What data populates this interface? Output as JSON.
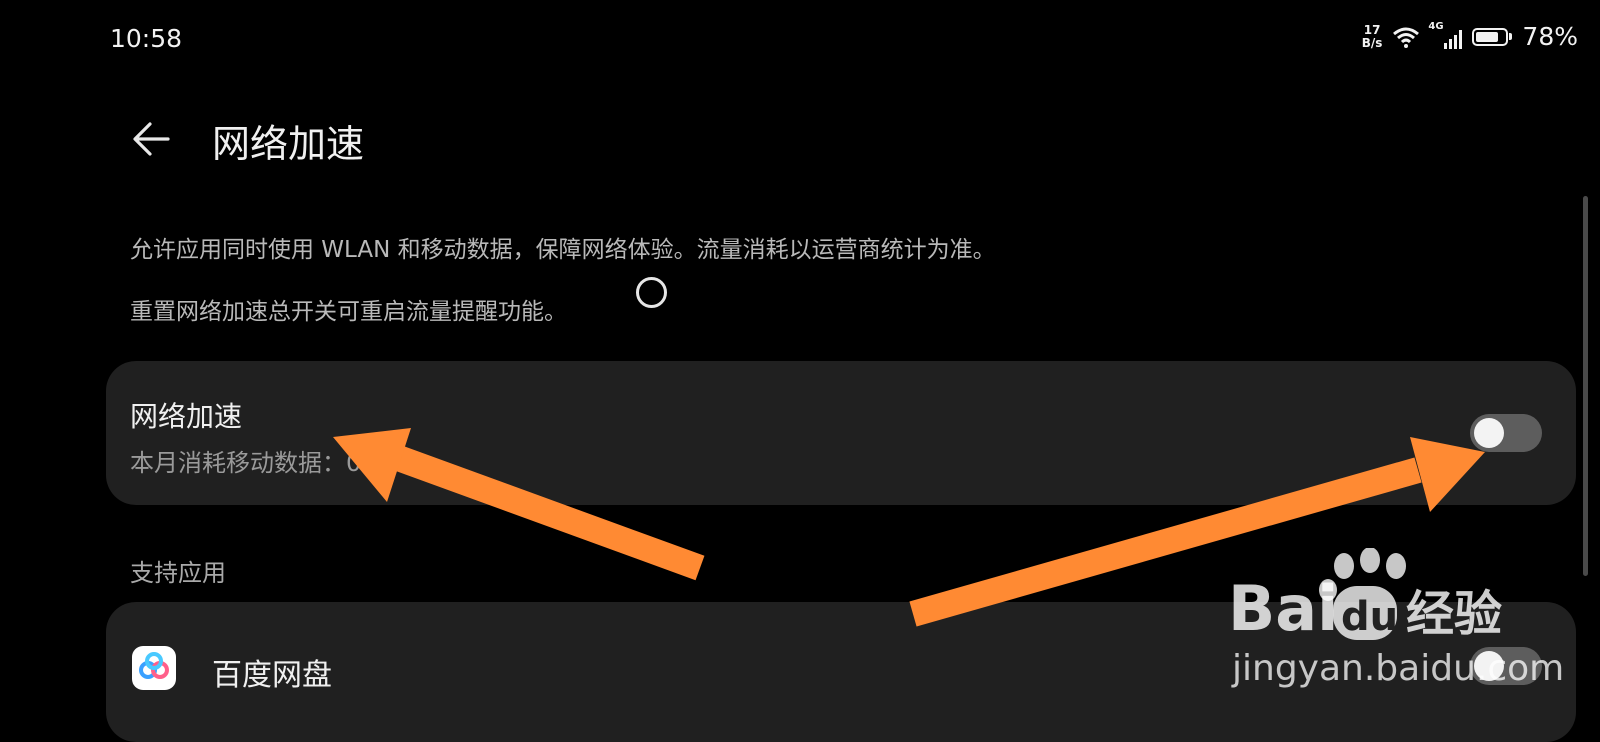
{
  "status_bar": {
    "time": "10:58",
    "net_speed_value": "17",
    "net_speed_unit": "B/s",
    "signal_type": "4G",
    "battery_percent": "78%",
    "icons": [
      "wifi-icon",
      "cellular-signal-icon",
      "battery-icon"
    ]
  },
  "header": {
    "back_icon": "back-arrow-icon",
    "title": "网络加速"
  },
  "description": {
    "line1": "允许应用同时使用 WLAN 和移动数据，保障网络体验。流量消耗以运营商统计为准。",
    "line2": "重置网络加速总开关可重启流量提醒功能。"
  },
  "accel_card": {
    "title": "网络加速",
    "subtitle": "本月消耗移动数据：0.00 B",
    "toggle_on": false
  },
  "supported_apps": {
    "section_label": "支持应用",
    "items": [
      {
        "name": "百度网盘",
        "icon": "baidu-netdisk-icon",
        "toggle_on": false
      }
    ]
  },
  "annotations": {
    "arrow_color": "#ff8a33",
    "arrows": [
      "arrow-to-network-accel-title",
      "arrow-to-network-accel-toggle"
    ]
  },
  "watermark": {
    "brand": "Bai",
    "brand_suffix": "du",
    "product": "经验",
    "url": "jingyan.baidu.com"
  },
  "colors": {
    "background": "#000000",
    "card": "#202020",
    "toggle_off": "#5d5d5d",
    "accent_arrow": "#ff8a33"
  }
}
